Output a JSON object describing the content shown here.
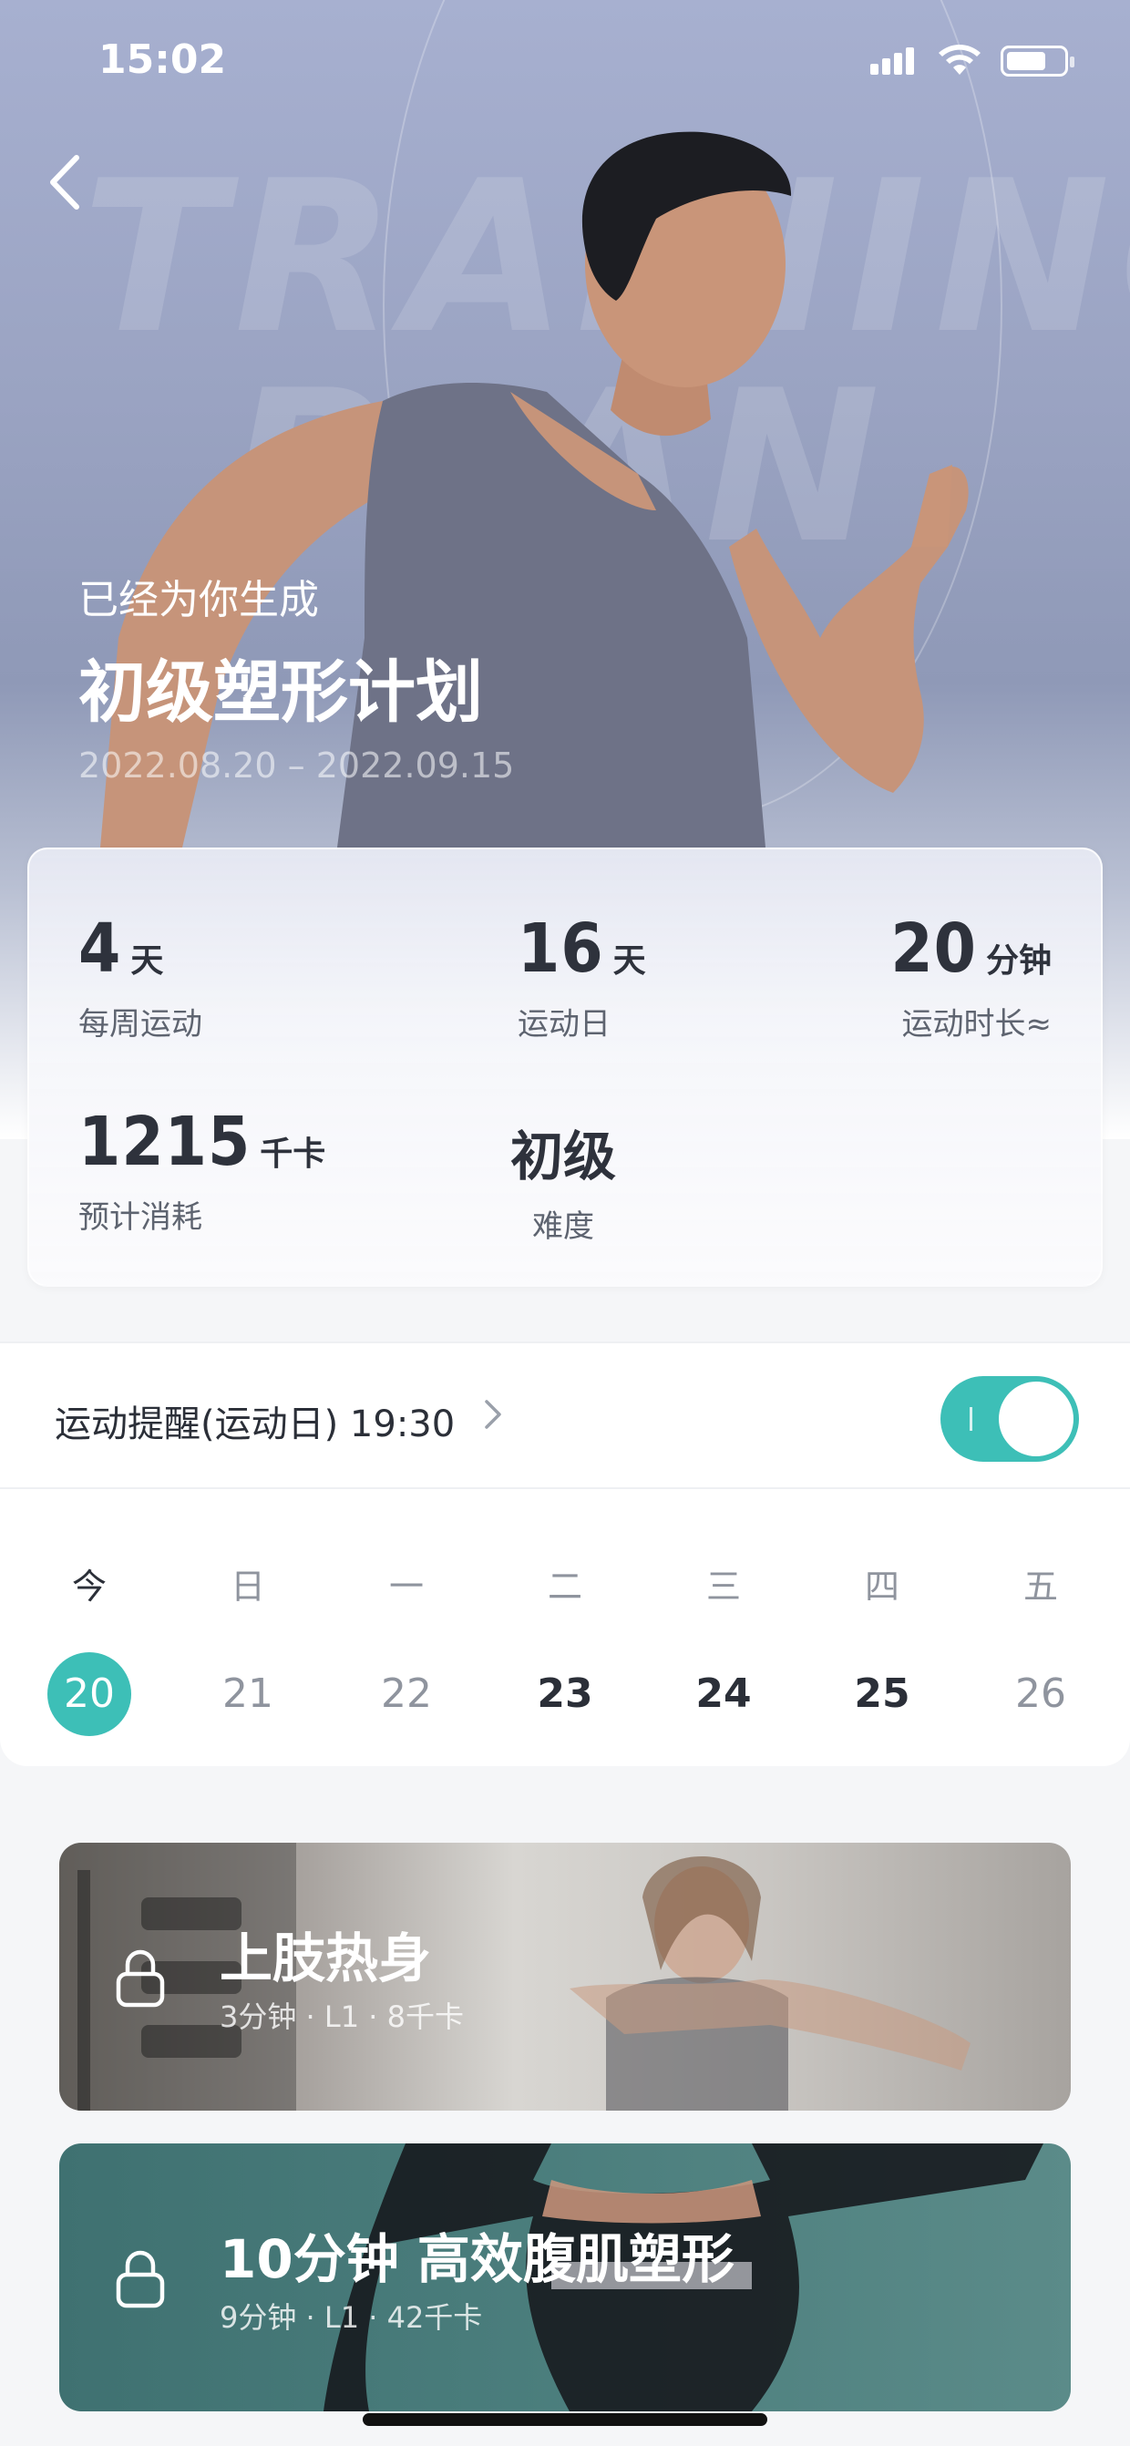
{
  "status_bar": {
    "time": "15:02"
  },
  "hero": {
    "bg_word_1": "TRAINING",
    "bg_word_2": "PLAN",
    "subtitle": "已经为你生成",
    "title": "初级塑形计划",
    "date_range": "2022.08.20 – 2022.09.15"
  },
  "stats": {
    "weekly": {
      "value": "4",
      "unit": "天",
      "label": "每周运动"
    },
    "days": {
      "value": "16",
      "unit": "天",
      "label": "运动日"
    },
    "duration": {
      "value": "20",
      "unit": "分钟",
      "label": "运动时长≈"
    },
    "calories": {
      "value": "1215",
      "unit": "千卡",
      "label": "预计消耗"
    },
    "difficulty": {
      "value": "初级",
      "label": "难度"
    }
  },
  "reminder": {
    "label": "运动提醒(运动日) 19:30",
    "enabled": true
  },
  "calendar": {
    "days": [
      {
        "weekday": "今",
        "date": "20",
        "state": "selected"
      },
      {
        "weekday": "日",
        "date": "21",
        "state": "rest"
      },
      {
        "weekday": "一",
        "date": "22",
        "state": "rest"
      },
      {
        "weekday": "二",
        "date": "23",
        "state": "active"
      },
      {
        "weekday": "三",
        "date": "24",
        "state": "active"
      },
      {
        "weekday": "四",
        "date": "25",
        "state": "active"
      },
      {
        "weekday": "五",
        "date": "26",
        "state": "rest"
      }
    ]
  },
  "courses": [
    {
      "title": "上肢热身",
      "meta": "3分钟 · L1 · 8千卡",
      "locked": true
    },
    {
      "title": "10分钟 高效腹肌塑形",
      "meta": "9分钟 · L1 · 42千卡",
      "locked": true
    }
  ],
  "colors": {
    "accent": "#3dbfb7",
    "text": "#2b2f38",
    "muted": "#8f949e"
  }
}
